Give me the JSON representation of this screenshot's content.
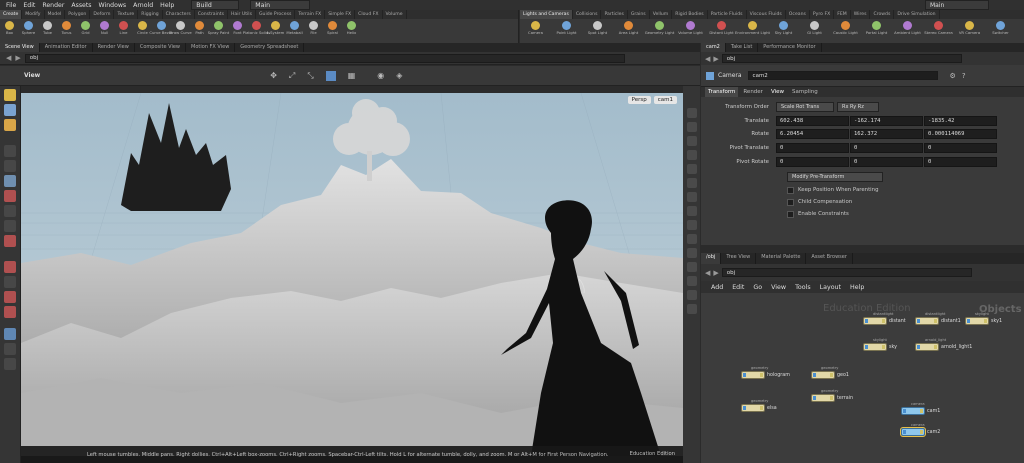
{
  "menubar": {
    "items": [
      "File",
      "Edit",
      "Render",
      "Assets",
      "Windows",
      "Arnold",
      "Help"
    ],
    "build": "Build",
    "desktop": "Main",
    "desktop_right": "Main"
  },
  "shelf_left": {
    "tabs": [
      "Create",
      "Modify",
      "Model",
      "Polygon",
      "Deform",
      "Texture",
      "Rigging",
      "Characters",
      "Constraints",
      "Hair Utils",
      "Guide Process",
      "Terrain FX",
      "Simple FX",
      "Cloud FX",
      "Volume"
    ],
    "tools": [
      "Box",
      "Sphere",
      "Tube",
      "Torus",
      "Grid",
      "Null",
      "Line",
      "Circle",
      "Curve Bezier",
      "Draw Curve",
      "Path",
      "Spray Paint",
      "Font",
      "Platonic Solids",
      "L-System",
      "Metaball",
      "File",
      "Spiral",
      "Helix"
    ]
  },
  "shelf_right": {
    "tabs": [
      "Lights and Cameras",
      "Collisions",
      "Particles",
      "Grains",
      "Vellum",
      "Rigid Bodies",
      "Particle Fluids",
      "Viscous Fluids",
      "Oceans",
      "Pyro FX",
      "FEM",
      "Wires",
      "Crowds",
      "Drive Simulation"
    ],
    "tools": [
      "Camera",
      "Point Light",
      "Spot Light",
      "Area Light",
      "Geometry Light",
      "Volume Light",
      "Distant Light",
      "Environment Light",
      "Sky Light",
      "GI Light",
      "Caustic Light",
      "Portal Light",
      "Ambient Light",
      "Stereo Camera",
      "VR Camera",
      "Switcher"
    ]
  },
  "pane_tabs_left": [
    "Scene View",
    "Animation Editor",
    "Render View",
    "Composite View",
    "Motion FX View",
    "Geometry Spreadsheet"
  ],
  "scene_path": "obj",
  "viewport": {
    "title": "View",
    "persp": "Persp",
    "cam": "cam1"
  },
  "status": {
    "message": "Left mouse tumbles. Middle pans. Right dollies. Ctrl+Alt+Left box-zooms. Ctrl+Right zooms. Spacebar-Ctrl-Left tilts. Hold L for alternate tumble, dolly, and zoom.     M or Alt+M for First Person Navigation.",
    "edition": "Education Edition"
  },
  "param_tabs": [
    "cam2",
    "Take List",
    "Performance Monitor"
  ],
  "param_path": "obj",
  "node_header": {
    "type": "Camera",
    "name": "cam2"
  },
  "param_sub_tabs": [
    "Transform",
    "Render",
    "View",
    "Sampling"
  ],
  "params": {
    "transform_order_label": "Transform Order",
    "transform_order": "Scale Rot Trans",
    "rot_order": "Rx Ry Rz",
    "translate_label": "Translate",
    "translate": [
      "602.438",
      "-162.174",
      "-1835.42"
    ],
    "rotate_label": "Rotate",
    "rotate": [
      "6.20454",
      "162.372",
      "0.000114069"
    ],
    "pivot_translate_label": "Pivot Translate",
    "pivot_translate": [
      "0",
      "0",
      "0"
    ],
    "pivot_rotate_label": "Pivot Rotate",
    "pivot_rotate": [
      "0",
      "0",
      "0"
    ],
    "modify_pre": "Modify Pre-Transform",
    "keep_position": "Keep Position When Parenting",
    "child_comp": "Child Compensation",
    "enable_constraints": "Enable Constraints"
  },
  "net_tabs": [
    "/obj",
    "Tree View",
    "Material Palette",
    "Asset Browser"
  ],
  "net_path": "obj",
  "net_menu": [
    "Add",
    "Edit",
    "Go",
    "View",
    "Tools",
    "Layout",
    "Help"
  ],
  "net_watermark": "Education Edition",
  "net_context": "Objects",
  "nodes": [
    {
      "type": "distantlight",
      "label": "distant"
    },
    {
      "type": "distantlight",
      "label": "distant1"
    },
    {
      "type": "skylight",
      "label": "sky1"
    },
    {
      "type": "skylight",
      "label": "sky"
    },
    {
      "type": "arnold_light",
      "label": "arnold_light1"
    },
    {
      "type": "geometry",
      "label": "hologram"
    },
    {
      "type": "geometry",
      "label": "geo1"
    },
    {
      "type": "geometry",
      "label": "terrain"
    },
    {
      "type": "geometry",
      "label": "elsa"
    },
    {
      "type": "camera",
      "label": "cam1"
    },
    {
      "type": "camera",
      "label": "cam2"
    }
  ],
  "colors": {
    "accent": "#e8c04a",
    "node_geo": "#e2d8a8",
    "node_cam": "#8ec7ec",
    "sky": "#a7bfce"
  }
}
